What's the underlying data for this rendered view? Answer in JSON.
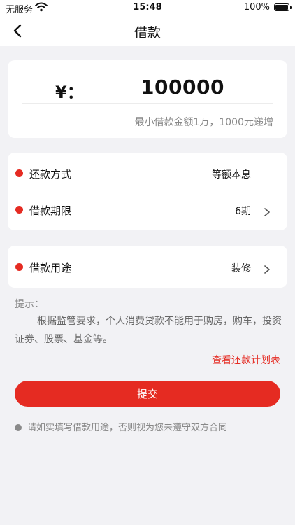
{
  "status_bar": {
    "carrier": "无服务",
    "time": "15:48",
    "battery": "100%"
  },
  "nav": {
    "title": "借款",
    "back_icon": "chevron-left-icon"
  },
  "amount": {
    "currency_label": "¥：",
    "value": "100000",
    "hint": "最小借款金额1万，1000元递增"
  },
  "options": {
    "repay_method": {
      "label": "还款方式",
      "value": "等额本息"
    },
    "term": {
      "label": "借款期限",
      "value": "6期"
    },
    "purpose": {
      "label": "借款用途",
      "value": "装修"
    }
  },
  "tips": {
    "title": "提示：",
    "body": "根据监管要求，个人消费贷款不能用于购房，购车，投资证券、股票、基金等。",
    "plan_link": "查看还款计划表"
  },
  "submit_label": "提交",
  "agreement": "请如实填写借款用途，否则视为您未遵守双方合同",
  "colors": {
    "accent": "#e52b22",
    "background": "#f2f2f5"
  }
}
